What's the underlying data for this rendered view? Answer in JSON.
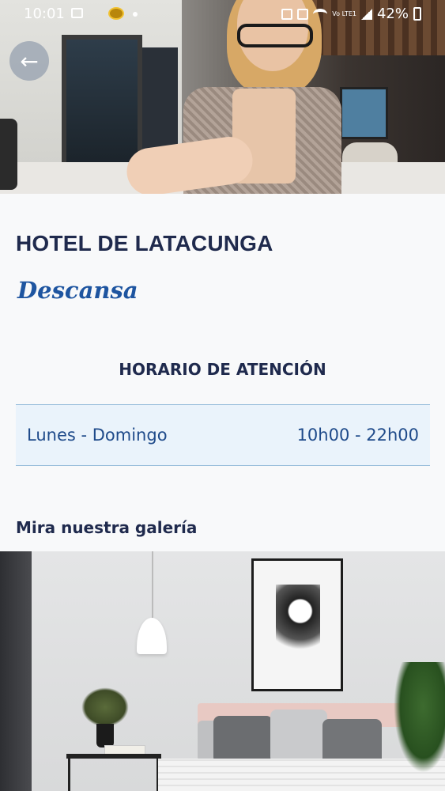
{
  "status_bar": {
    "time": "10:01",
    "battery": "42%",
    "network": "Vo LTE1"
  },
  "header": {
    "back_icon": "arrow-left-icon"
  },
  "hotel": {
    "name": "HOTEL DE LATACUNGA",
    "tagline": "Descansa"
  },
  "hours": {
    "heading": "HORARIO DE ATENCIÓN",
    "rows": [
      {
        "days": "Lunes - Domingo",
        "time": "10h00 - 22h00"
      }
    ]
  },
  "gallery": {
    "title": "Mira nuestra galería"
  },
  "colors": {
    "title": "#1f2a4d",
    "accent": "#1e55a0",
    "row_bg": "#eaf3fb"
  }
}
